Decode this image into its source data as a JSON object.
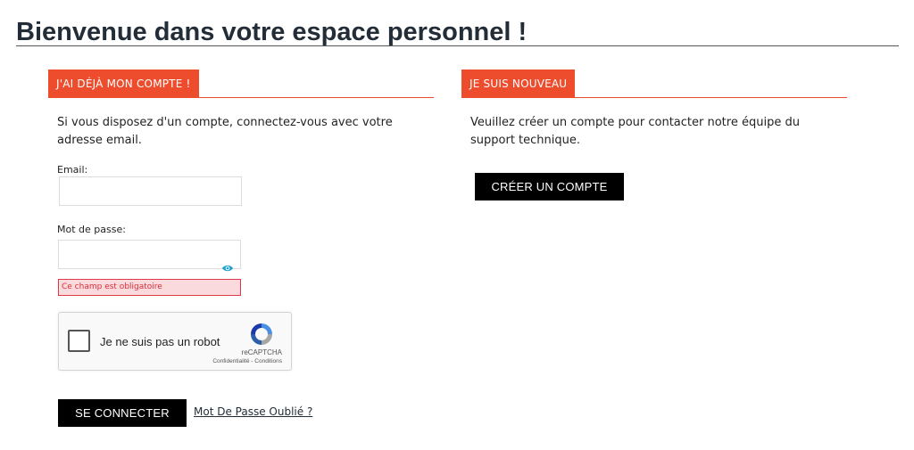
{
  "page": {
    "title": "Bienvenue dans votre espace personnel !"
  },
  "login": {
    "section_title": "J'AI DÉJÀ MON COMPTE !",
    "intro": "Si vous disposez d'un compte, connectez-vous avec votre adresse email.",
    "email_label": "Email:",
    "email_value": "",
    "password_label": "Mot de passe:",
    "password_value": "",
    "error": "Ce champ est obligatoire",
    "submit_label": "SE CONNECTER",
    "forgot_label": "Mot De Passe Oublié ?"
  },
  "recaptcha": {
    "label": "Je ne suis pas un robot",
    "brand": "reCAPTCHA",
    "links": "Confidentialité - Conditions",
    "logo_icon": "recaptcha-logo-icon"
  },
  "register": {
    "section_title": "JE SUIS NOUVEAU",
    "intro": "Veuillez créer un compte pour contacter notre équipe du support technique.",
    "create_label": "CRÉER UN COMPTE"
  },
  "colors": {
    "accent": "#ee4d2d",
    "error_bg": "#fadadd",
    "error_text": "#d92d3a",
    "button": "#000000"
  },
  "icons": {
    "password_toggle": "eye-icon"
  }
}
